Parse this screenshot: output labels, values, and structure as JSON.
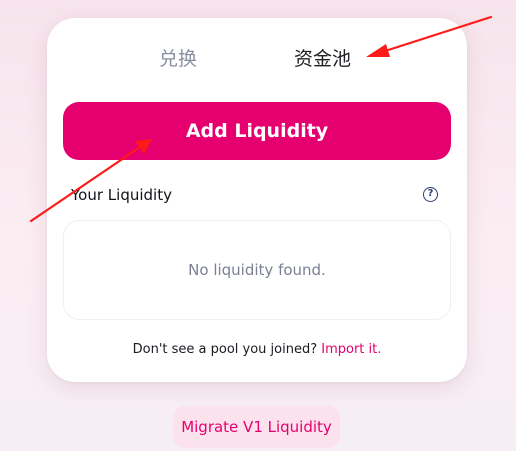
{
  "tabs": [
    {
      "label": "兑换",
      "active": false
    },
    {
      "label": "资金池",
      "active": true
    }
  ],
  "add_liquidity_label": "Add Liquidity",
  "your_liquidity_label": "Your Liquidity",
  "help_icon": "question-circle-icon",
  "empty_message": "No liquidity found.",
  "footer": {
    "text": "Don't see a pool you joined?",
    "link": "Import it."
  },
  "migrate_label": "Migrate V1 Liquidity",
  "colors": {
    "accent": "#e6006f",
    "annotation_arrow": "#ff1a1a"
  }
}
